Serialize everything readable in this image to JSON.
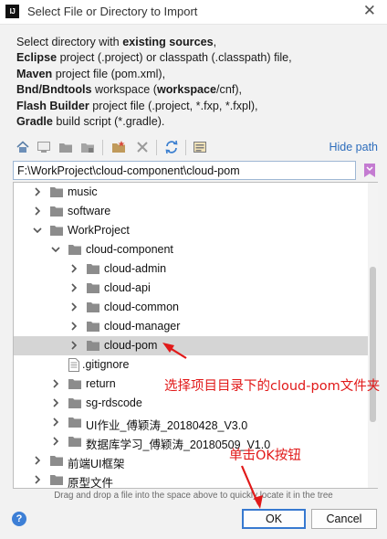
{
  "window": {
    "title": "Select File or Directory to Import",
    "app_icon_text": "IJ",
    "close_glyph": "✕"
  },
  "description_lines": [
    [
      {
        "t": "Select directory with "
      },
      {
        "t": "existing sources",
        "b": true
      },
      {
        "t": ","
      }
    ],
    [
      {
        "t": "Eclipse",
        "b": true
      },
      {
        "t": " project (.project) or classpath (.classpath) file,"
      }
    ],
    [
      {
        "t": "Maven",
        "b": true
      },
      {
        "t": " project file (pom.xml),"
      }
    ],
    [
      {
        "t": "Bnd/Bndtools",
        "b": true
      },
      {
        "t": " workspace ("
      },
      {
        "t": "workspace",
        "b": true
      },
      {
        "t": "/cnf),"
      }
    ],
    [
      {
        "t": "Flash Builder",
        "b": true
      },
      {
        "t": " project file (.project, *.fxp, *.fxpl),"
      }
    ],
    [
      {
        "t": "Gradle",
        "b": true
      },
      {
        "t": " build script (*.gradle)."
      }
    ]
  ],
  "toolbar": {
    "icons": [
      "home-icon",
      "desktop-icon",
      "project-folder-icon",
      "module-folder-icon",
      "new-folder-icon",
      "delete-icon",
      "refresh-icon",
      "show-hidden-icon"
    ],
    "hide_path_label": "Hide path"
  },
  "path": {
    "value": "F:\\WorkProject\\cloud-component\\cloud-pom"
  },
  "tree": [
    {
      "label": "music",
      "level": 0,
      "expanded": false,
      "type": "folder"
    },
    {
      "label": "software",
      "level": 0,
      "expanded": false,
      "type": "folder"
    },
    {
      "label": "WorkProject",
      "level": 0,
      "expanded": true,
      "type": "folder"
    },
    {
      "label": "cloud-component",
      "level": 1,
      "expanded": true,
      "type": "folder"
    },
    {
      "label": "cloud-admin",
      "level": 2,
      "expanded": false,
      "type": "folder"
    },
    {
      "label": "cloud-api",
      "level": 2,
      "expanded": false,
      "type": "folder"
    },
    {
      "label": "cloud-common",
      "level": 2,
      "expanded": false,
      "type": "folder"
    },
    {
      "label": "cloud-manager",
      "level": 2,
      "expanded": false,
      "type": "folder"
    },
    {
      "label": "cloud-pom",
      "level": 2,
      "expanded": false,
      "type": "folder",
      "selected": true
    },
    {
      "label": ".gitignore",
      "level": 3,
      "expanded": null,
      "type": "file"
    },
    {
      "label": "return",
      "level": 1,
      "expanded": false,
      "type": "folder"
    },
    {
      "label": "sg-rdscode",
      "level": 1,
      "expanded": false,
      "type": "folder"
    },
    {
      "label": "UI作业_傅颖涛_20180428_V3.0",
      "level": 1,
      "expanded": false,
      "type": "folder"
    },
    {
      "label": "数据库学习_傅颖涛_20180509_V1.0",
      "level": 1,
      "expanded": false,
      "type": "folder"
    },
    {
      "label": "前端UI框架",
      "level": 0,
      "expanded": false,
      "type": "folder"
    },
    {
      "label": "原型文件",
      "level": 0,
      "expanded": false,
      "type": "folder"
    }
  ],
  "hint": "Drag and drop a file into the space above to quickly locate it in the tree",
  "buttons": {
    "help": "?",
    "ok": "OK",
    "cancel": "Cancel"
  },
  "annotations": {
    "select_note": "选择项目目录下的cloud-pom文件夹",
    "click_note": "单击OK按钮",
    "color": "#e11919"
  },
  "colors": {
    "link": "#2d6dbc",
    "selection": "#d5d5d5",
    "ok_border": "#3779d0",
    "folder": "#8c8c8c"
  }
}
